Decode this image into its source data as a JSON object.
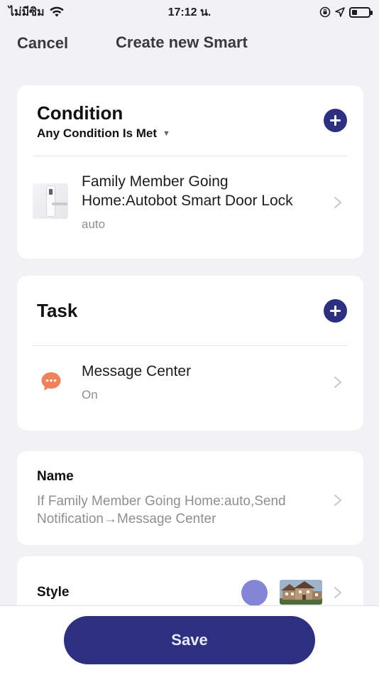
{
  "status_bar": {
    "carrier": "ไม่มีซิม",
    "time": "17:12 น.",
    "battery_level": 0.3
  },
  "nav": {
    "cancel_label": "Cancel",
    "title": "Create new Smart"
  },
  "condition": {
    "title": "Condition",
    "mode_label": "Any Condition Is Met",
    "items": [
      {
        "title": "Family Member Going Home:Autobot Smart Door Lock",
        "subtitle": "auto",
        "icon": "door-lock-device-icon"
      }
    ]
  },
  "task": {
    "title": "Task",
    "items": [
      {
        "title": "Message Center",
        "subtitle": "On",
        "icon": "message-bubble-icon"
      }
    ]
  },
  "name": {
    "label": "Name",
    "value": "If Family Member Going Home:auto,Send Notification→Message Center"
  },
  "style": {
    "label": "Style",
    "color": "#8286d4"
  },
  "save_label": "Save",
  "colors": {
    "accent": "#2d2f7f",
    "message_icon": "#f0825a",
    "background": "#f2f2f4"
  }
}
